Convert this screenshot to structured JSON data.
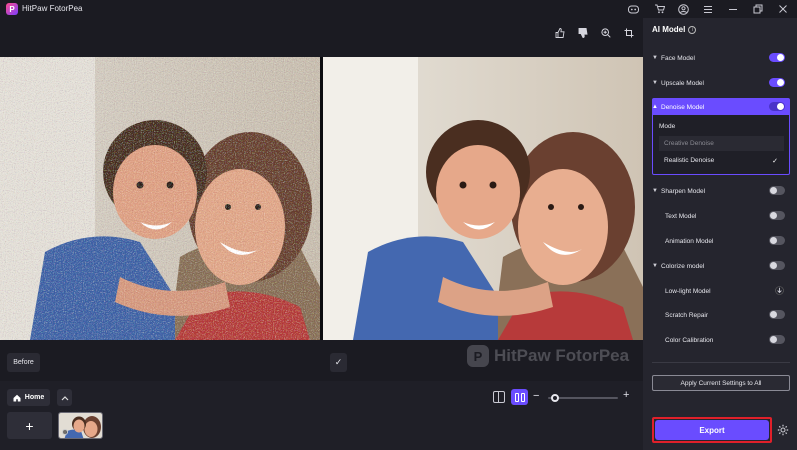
{
  "app": {
    "title": "HitPaw FotorPea",
    "logo_letter": "P"
  },
  "window_controls": {
    "discord": "discord-icon",
    "cart": "cart-icon",
    "account": "account-icon",
    "menu": "menu-icon",
    "minimize": "minimize-icon",
    "restore": "restore-icon",
    "close": "close-icon"
  },
  "view_tools": [
    "thumbs-up-icon",
    "thumbs-down-icon",
    "zoom-in-icon",
    "crop-icon"
  ],
  "preview": {
    "before_label": "Before",
    "after_check": "✓",
    "watermark": "HitPaw FotorPea"
  },
  "bottom": {
    "home_label": "Home",
    "add_symbol": "+",
    "zoom_minus": "−",
    "zoom_plus": "+",
    "zoom_level": 0.04
  },
  "panel": {
    "title": "AI Model",
    "models": [
      {
        "label": "Face Model",
        "expandable": true,
        "enabled": true
      },
      {
        "label": "Upscale Model",
        "expandable": true,
        "enabled": true
      },
      {
        "label": "Denoise Model",
        "expandable": true,
        "enabled": true,
        "expanded": true
      },
      {
        "label": "Sharpen Model",
        "expandable": true,
        "enabled": false
      },
      {
        "label": "Text Model",
        "expandable": false,
        "enabled": false
      },
      {
        "label": "Animation Model",
        "expandable": false,
        "enabled": false
      },
      {
        "label": "Colorize model",
        "expandable": true,
        "enabled": false
      },
      {
        "label": "Low-light Model",
        "expandable": false,
        "download": true
      },
      {
        "label": "Scratch Repair",
        "expandable": false,
        "enabled": false
      },
      {
        "label": "Color Calibration",
        "expandable": false,
        "enabled": false
      }
    ],
    "denoise": {
      "mode_label": "Mode",
      "options": [
        {
          "label": "Creative Denoise",
          "selected": false
        },
        {
          "label": "Realistic Denoise",
          "selected": true
        }
      ]
    },
    "apply_label": "Apply Current Settings to All",
    "export_label": "Export"
  },
  "colors": {
    "accent": "#6a4cff",
    "panel_bg": "#25252e",
    "app_bg": "#1b1b22",
    "highlight_border": "#e0202a"
  }
}
